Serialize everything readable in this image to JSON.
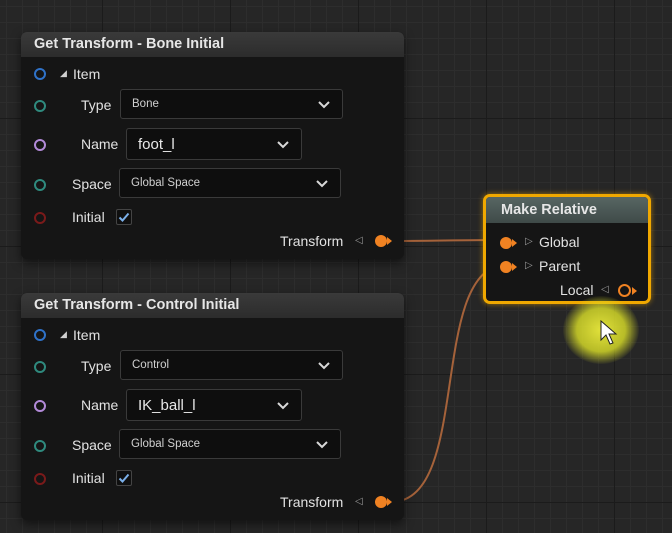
{
  "nodes": {
    "bone": {
      "title": "Get Transform - Bone Initial",
      "item_label": "Item",
      "type_label": "Type",
      "type_value": "Bone",
      "name_label": "Name",
      "name_value": "foot_l",
      "space_label": "Space",
      "space_value": "Global Space",
      "initial_label": "Initial",
      "initial_checked": true,
      "output_label": "Transform"
    },
    "control": {
      "title": "Get Transform - Control Initial",
      "item_label": "Item",
      "type_label": "Type",
      "type_value": "Control",
      "name_label": "Name",
      "name_value": "IK_ball_l",
      "space_label": "Space",
      "space_value": "Global Space",
      "initial_label": "Initial",
      "initial_checked": true,
      "output_label": "Transform"
    },
    "make_relative": {
      "title": "Make Relative",
      "input_global_label": "Global",
      "input_parent_label": "Parent",
      "output_local_label": "Local"
    }
  },
  "colors": {
    "transform_pin": "#f08222",
    "selection_outline": "#f0a800",
    "wire": "#a5623a"
  },
  "icons": [
    "expand-triangle-icon",
    "chevron-down-icon",
    "checkmark-icon",
    "pin-arrow-icon",
    "mouse-cursor-icon"
  ]
}
